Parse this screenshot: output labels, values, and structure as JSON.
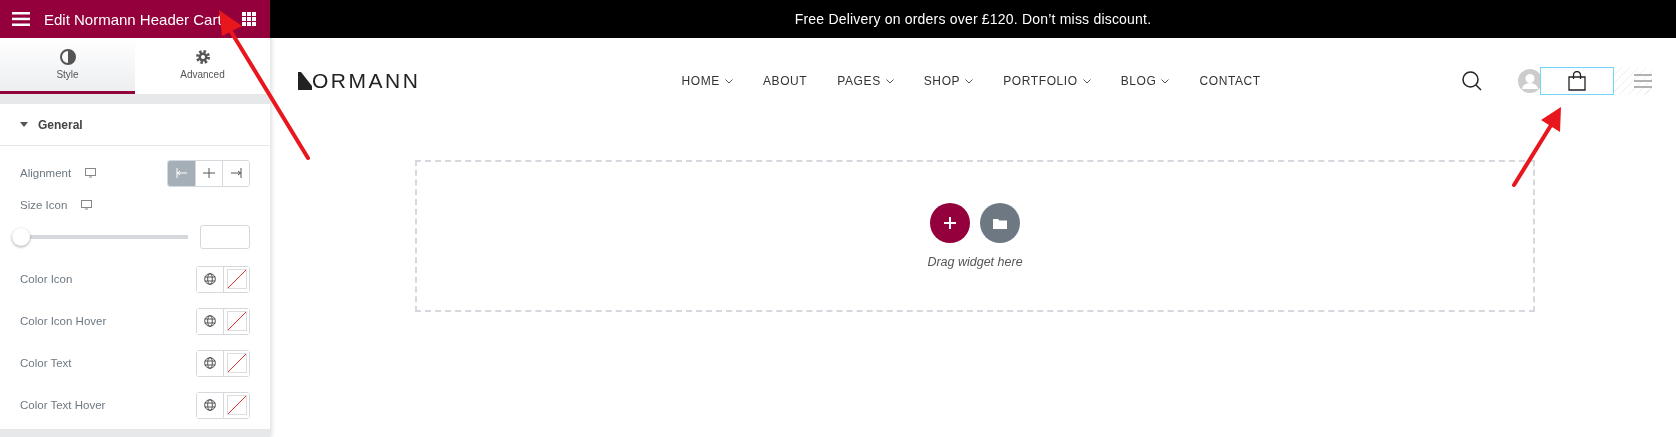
{
  "panel": {
    "title": "Edit Normann Header Cart",
    "tabs": [
      {
        "label": "Style",
        "selected": true
      },
      {
        "label": "Advanced",
        "selected": false
      }
    ],
    "section": {
      "title": "General",
      "expanded": true
    },
    "controls": [
      {
        "kind": "choose",
        "label": "Alignment",
        "responsive": true,
        "options": [
          {
            "selected": true
          },
          {
            "selected": false
          },
          {
            "selected": false
          }
        ]
      },
      {
        "kind": "slider",
        "label": "Size Icon",
        "responsive": true,
        "level": 0
      },
      {
        "kind": "color",
        "label": "Color Icon"
      },
      {
        "kind": "color",
        "label": "Color Icon Hover"
      },
      {
        "kind": "color",
        "label": "Color Text"
      },
      {
        "kind": "color",
        "label": "Color Text Hover"
      }
    ]
  },
  "banner": "Free Delivery on orders over £120. Don’t miss discount.",
  "logo": "ORMANN",
  "nav": [
    {
      "label": "HOME",
      "dropdown": true
    },
    {
      "label": "ABOUT",
      "dropdown": false
    },
    {
      "label": "PAGES",
      "dropdown": true
    },
    {
      "label": "SHOP",
      "dropdown": true
    },
    {
      "label": "PORTFOLIO",
      "dropdown": true
    },
    {
      "label": "BLOG",
      "dropdown": true
    },
    {
      "label": "CONTACT",
      "dropdown": false
    }
  ],
  "dropzone": {
    "hint": "Drag widget here"
  }
}
